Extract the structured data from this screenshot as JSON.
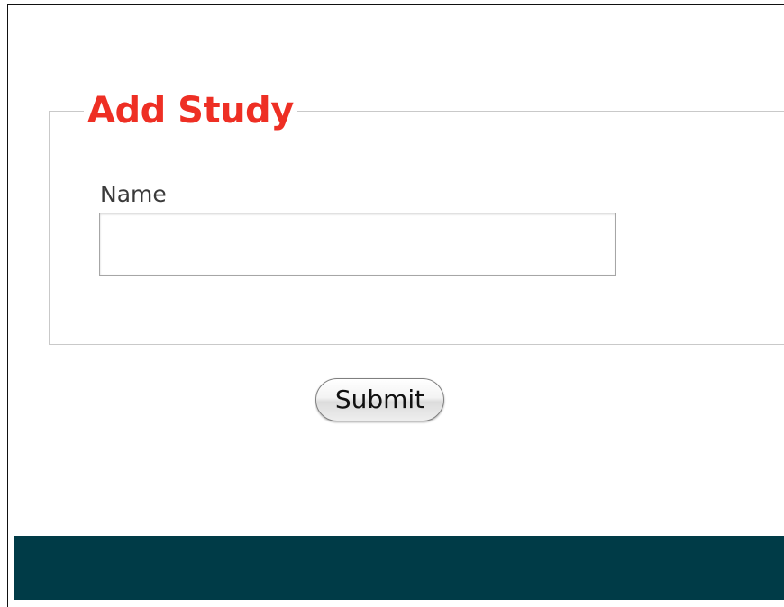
{
  "form": {
    "legend": "Add Study",
    "name_label": "Name",
    "name_value": "",
    "submit_label": "Submit"
  },
  "colors": {
    "legend": "#ee2f24",
    "footer": "#003b47"
  }
}
